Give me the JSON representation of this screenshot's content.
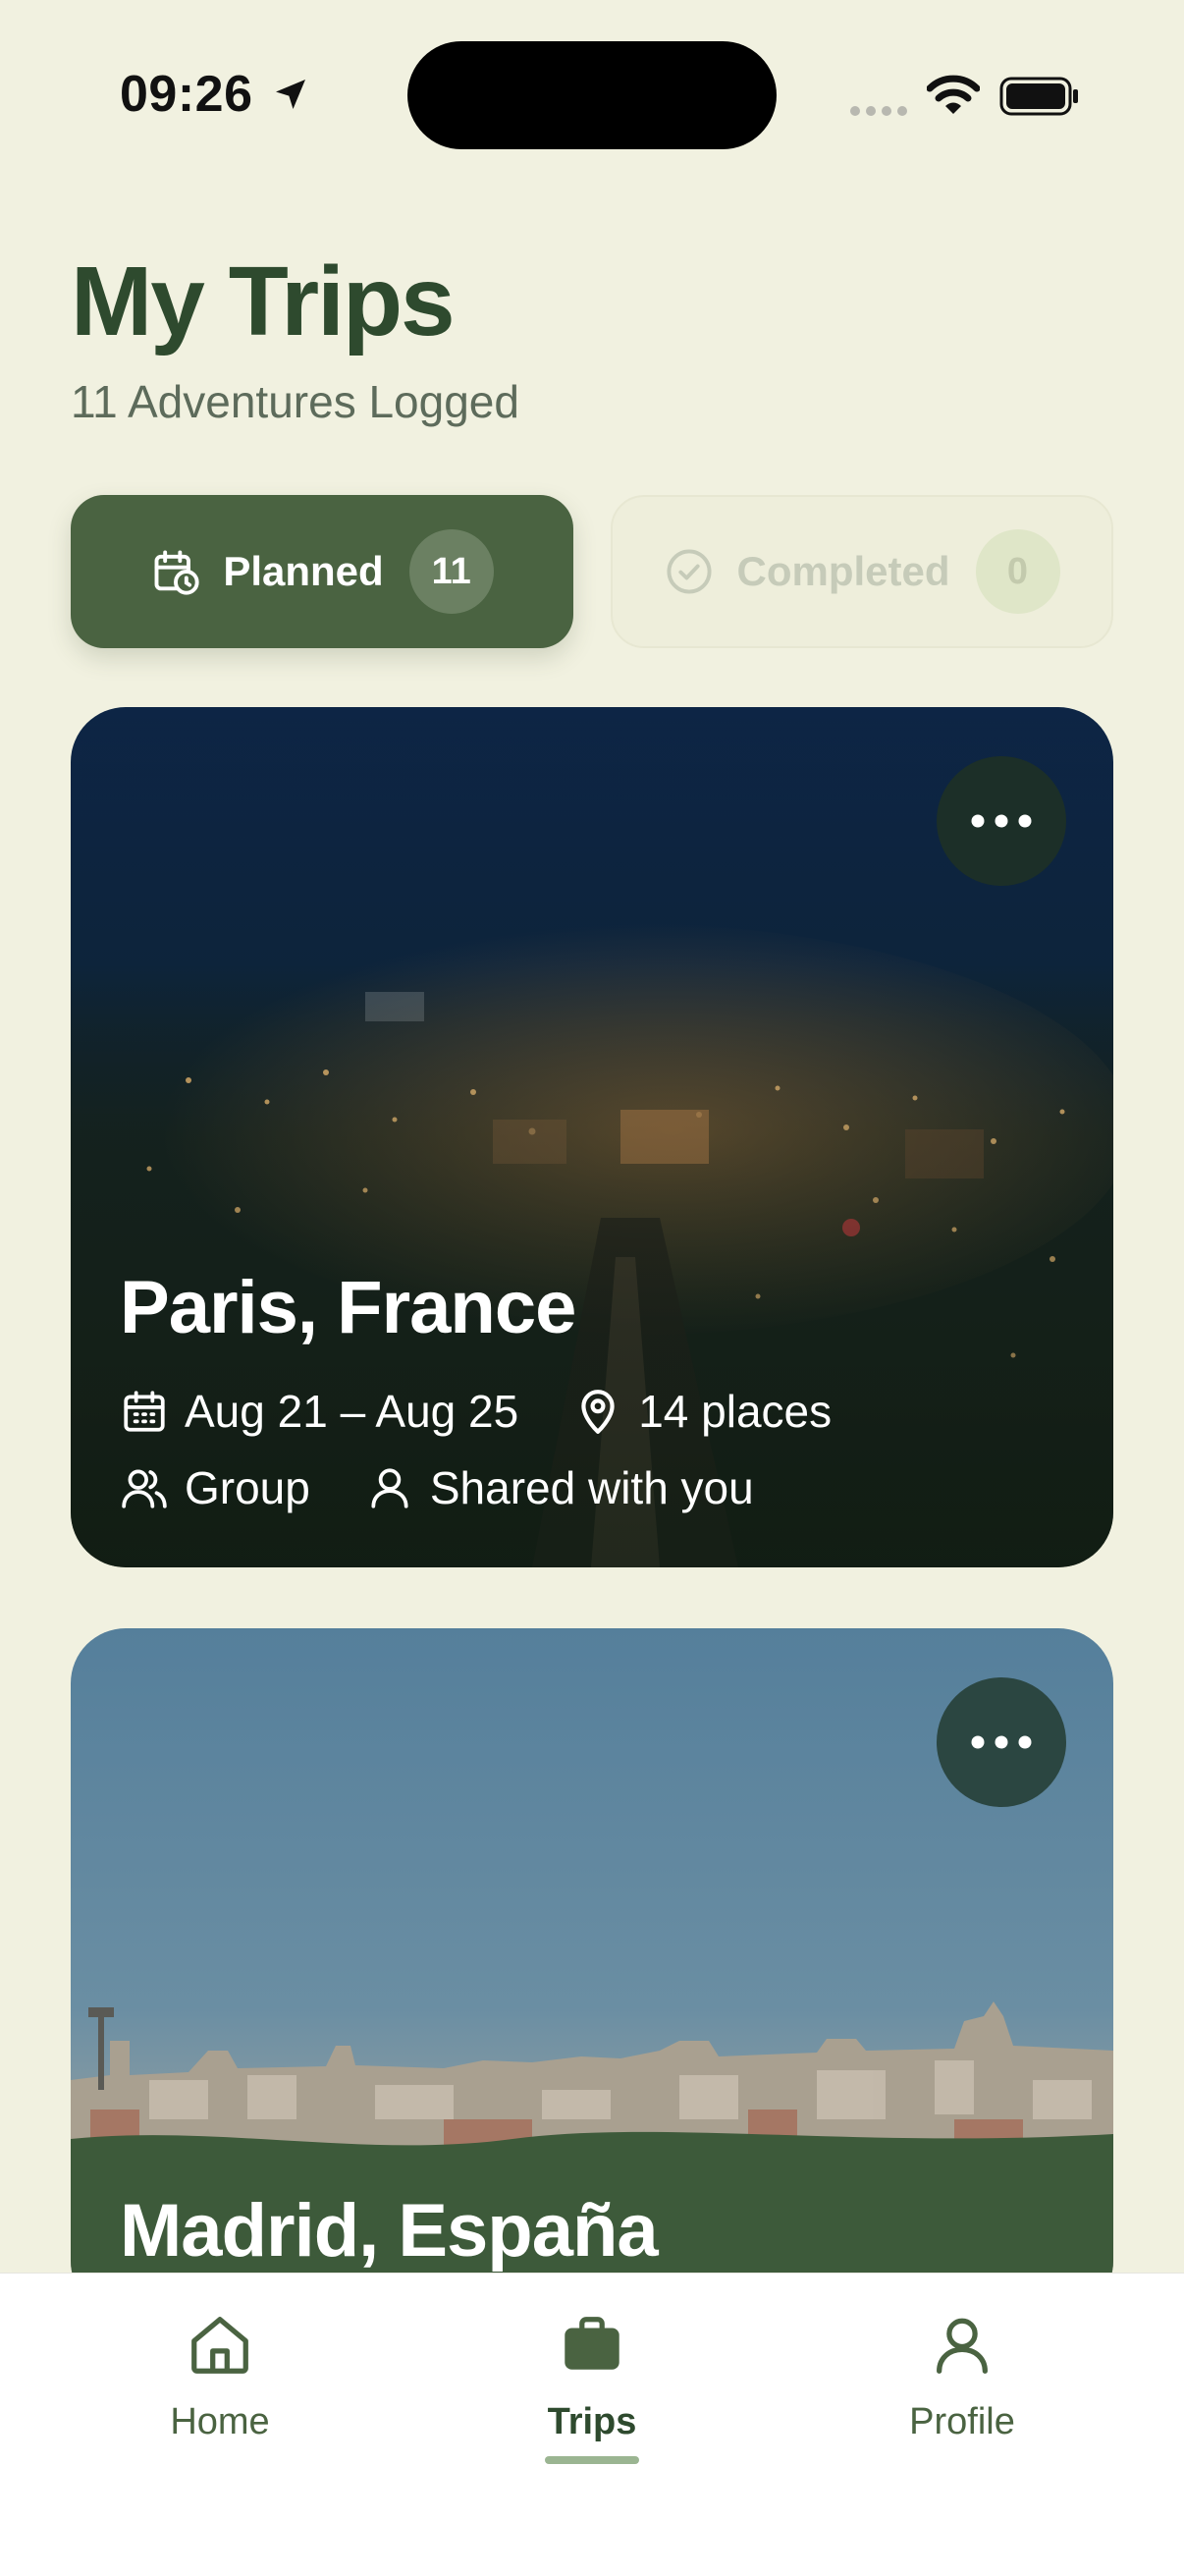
{
  "status_bar": {
    "time": "09:26"
  },
  "header": {
    "title": "My Trips",
    "subtitle": "11 Adventures Logged"
  },
  "tabs": [
    {
      "label": "Planned",
      "count": "11",
      "active": true,
      "icon": "calendar-clock-icon"
    },
    {
      "label": "Completed",
      "count": "0",
      "active": false,
      "icon": "check-circle-icon"
    }
  ],
  "trips": [
    {
      "title": "Paris, France",
      "dates": "Aug 21 – Aug 25",
      "places": "14 places",
      "type": "Group",
      "sharing": "Shared with you"
    },
    {
      "title": "Madrid, España"
    }
  ],
  "bottom_nav": [
    {
      "label": "Home",
      "icon": "home-icon"
    },
    {
      "label": "Trips",
      "icon": "briefcase-icon",
      "active": true
    },
    {
      "label": "Profile",
      "icon": "person-icon"
    }
  ],
  "colors": {
    "background": "#f1f1e0",
    "accent": "#4a6341",
    "title": "#2e4a2e"
  }
}
